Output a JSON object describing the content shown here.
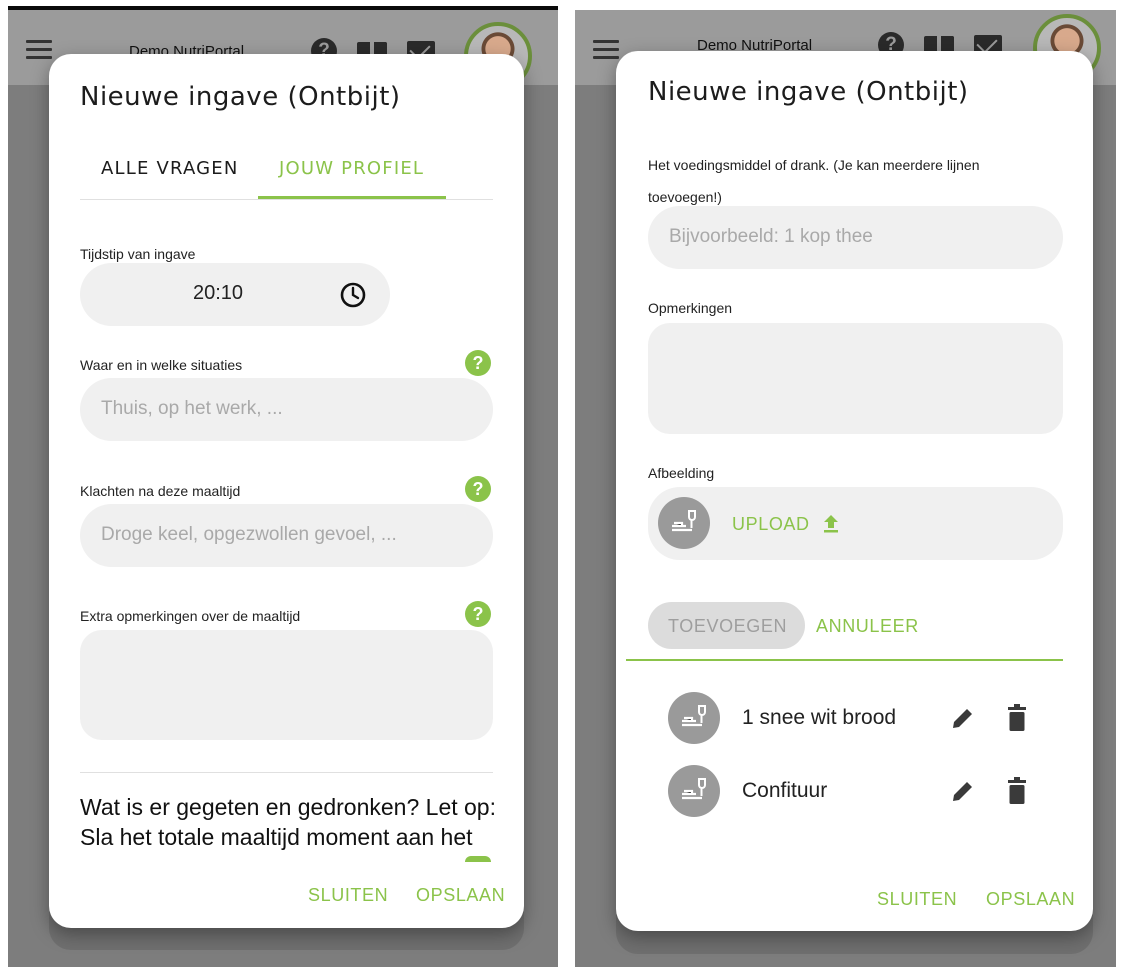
{
  "header": {
    "menu_icon": "menu-icon",
    "title": "Demo NutriPortal",
    "help_icon": "help-icon",
    "book_icon": "book-icon",
    "mail_icon": "mail-icon",
    "avatar": "avatar"
  },
  "left_dialog": {
    "title": "Nieuwe ingave (Ontbijt)",
    "tabs": [
      {
        "label": "ALLE VRAGEN",
        "active": false
      },
      {
        "label": "JOUW PROFIEL",
        "active": true
      }
    ],
    "time_field": {
      "label": "Tijdstip van ingave",
      "value": "20:10",
      "icon": "clock-icon"
    },
    "situation_field": {
      "label": "Waar en in welke situaties",
      "placeholder": "Thuis, op het werk, ..."
    },
    "complaints_field": {
      "label": "Klachten na deze maaltijd",
      "placeholder": "Droge keel, opgezwollen gevoel, ..."
    },
    "extra_field": {
      "label": "Extra opmerkingen over de maaltijd"
    },
    "question_text": "Wat is er gegeten en gedronken? Let op: Sla het totale maaltijd moment aan het",
    "actions": {
      "close": "SLUITEN",
      "save": "OPSLAAN"
    }
  },
  "right_dialog": {
    "title": "Nieuwe ingave (Ontbijt)",
    "food_field": {
      "label": "Het voedingsmiddel of drank. (Je kan meerdere lijnen toevoegen!)",
      "placeholder": "Bijvoorbeeld: 1 kop thee"
    },
    "remarks_field": {
      "label": "Opmerkingen"
    },
    "image_field": {
      "label": "Afbeelding",
      "upload_label": "UPLOAD",
      "upload_icon": "upload-icon"
    },
    "add_button": "TOEVOEGEN",
    "cancel_button": "ANNULEER",
    "items": [
      {
        "label": "1 snee wit brood"
      },
      {
        "label": "Confituur"
      }
    ],
    "actions": {
      "close": "SLUITEN",
      "save": "OPSLAAN"
    }
  },
  "colors": {
    "accent": "#8bc34a",
    "input_bg": "#f0f0f0",
    "overlay": "#7d7d7d"
  }
}
